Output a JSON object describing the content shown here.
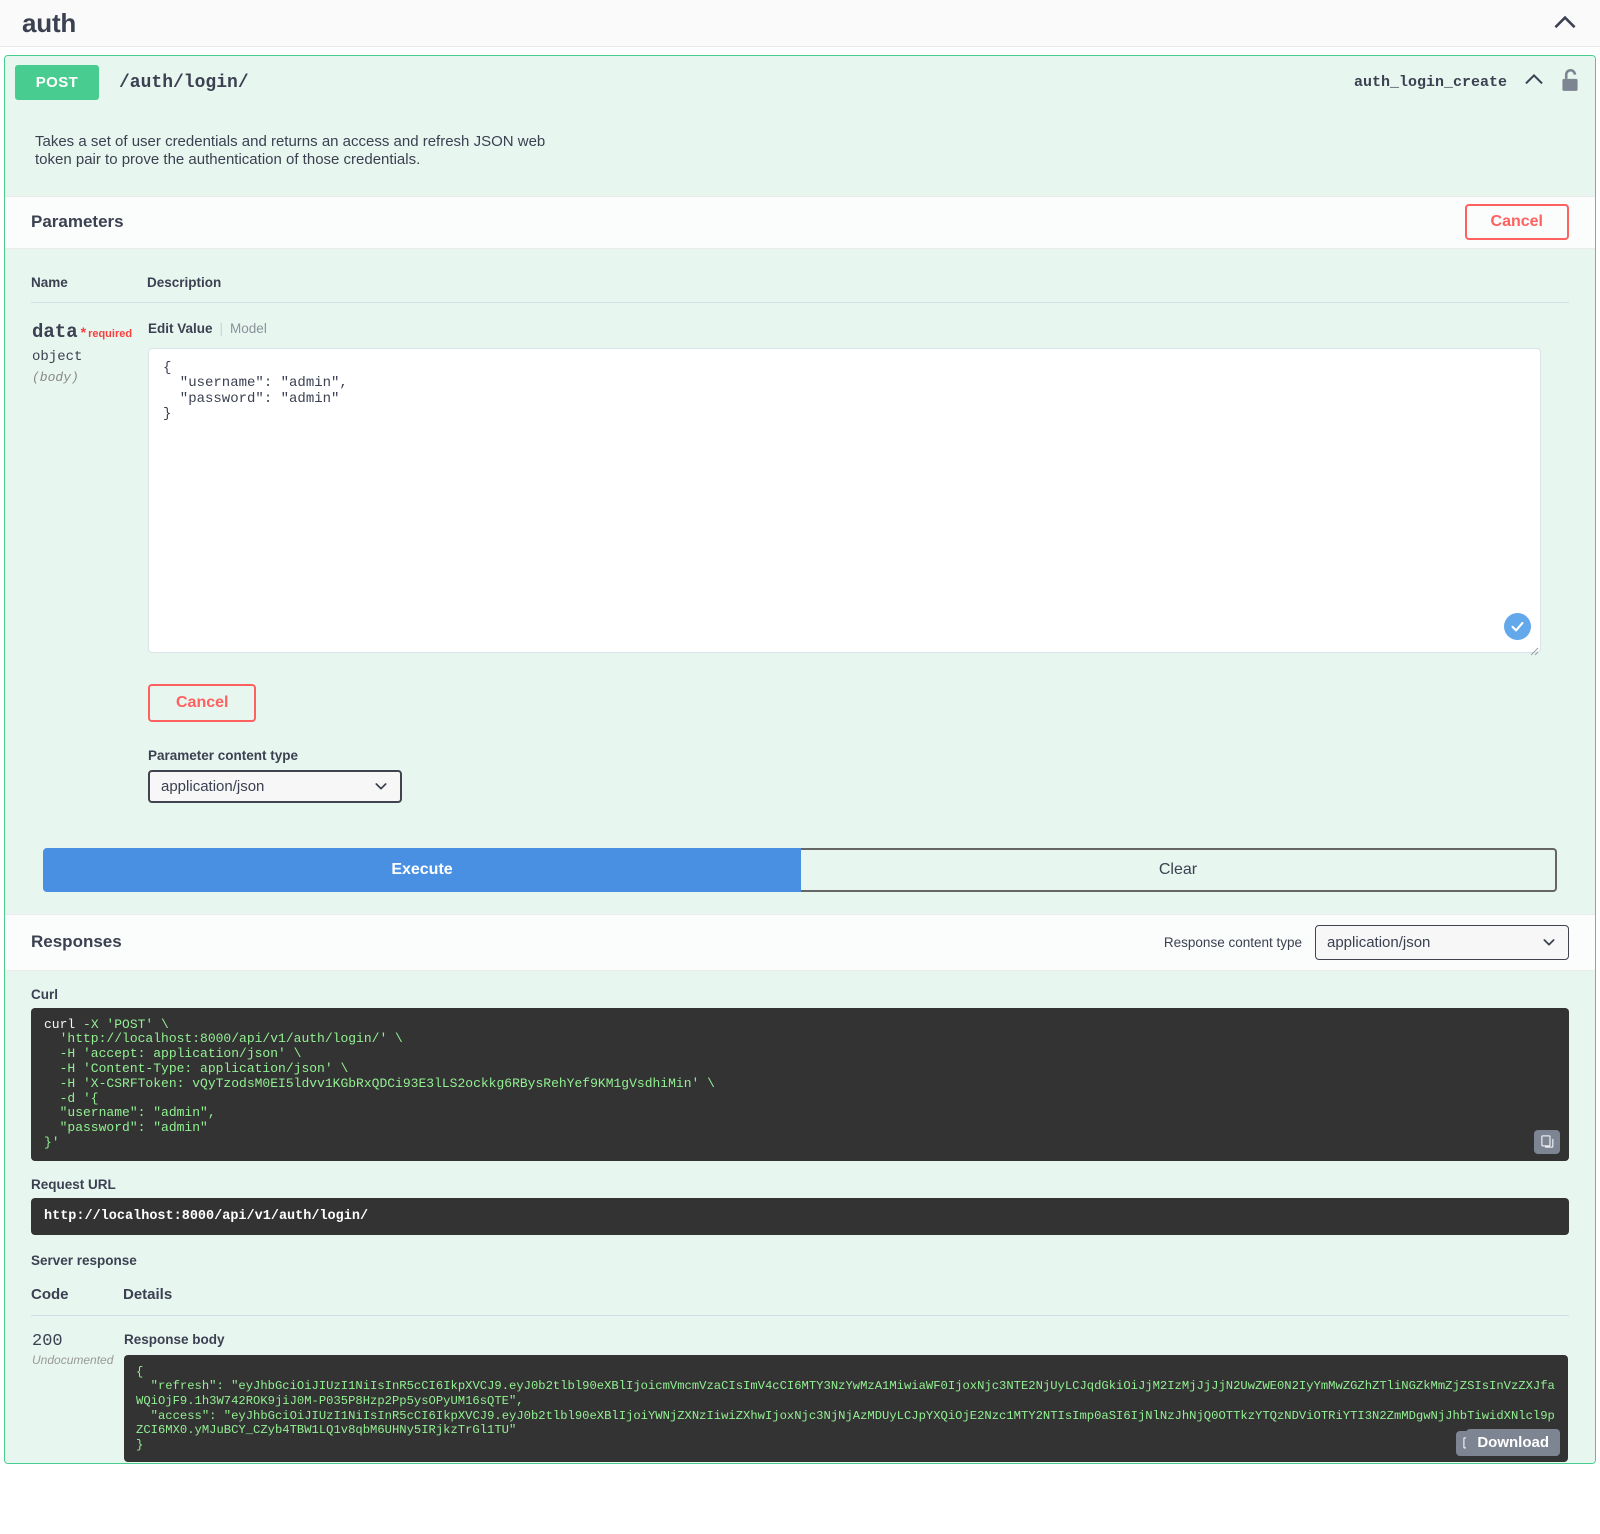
{
  "tag": {
    "title": "auth",
    "collapse_icon": "chevron-up-icon"
  },
  "operation": {
    "method": "POST",
    "path": "/auth/login/",
    "operation_id": "auth_login_create",
    "collapse_icon": "chevron-up-icon",
    "auth_icon": "unlocked-padlock-icon",
    "description": "Takes a set of user credentials and returns an access and refresh JSON web\ntoken pair to prove the authentication of those credentials.",
    "method_color": "#49cc90"
  },
  "parameters": {
    "section_title": "Parameters",
    "cancel_label": "Cancel",
    "columns": {
      "name": "Name",
      "description": "Description"
    },
    "rows": [
      {
        "name": "data",
        "required_star": "*",
        "required_label": "required",
        "type": "object",
        "location": "(body)",
        "tab_edit": "Edit Value",
        "tab_model": "Model",
        "editor_value": "{\n  \"username\": \"admin\",\n  \"password\": \"admin\"\n}",
        "valid_icon": "checkmark-circle-icon",
        "cancel_label": "Cancel",
        "content_type_label": "Parameter content type",
        "content_type_value": "application/json"
      }
    ]
  },
  "actions": {
    "execute_label": "Execute",
    "clear_label": "Clear",
    "execute_color": "#4990e2"
  },
  "responses": {
    "section_title": "Responses",
    "content_type_label": "Response content type",
    "content_type_value": "application/json",
    "curl_label": "Curl",
    "curl_command_head": "curl",
    "curl_command_rest": " -X 'POST' \\\n  'http://localhost:8000/api/v1/auth/login/' \\\n  -H 'accept: application/json' \\\n  -H 'Content-Type: application/json' \\\n  -H 'X-CSRFToken: vQyTzodsM0EI5ldvv1KGbRxQDCi93E3lLS2ockkg6RBysRehYef9KM1gVsdhiMin' \\\n  -d '{\n  \"username\": \"admin\",\n  \"password\": \"admin\"\n}'",
    "copy_icon": "copy-to-clipboard-icon",
    "request_url_label": "Request URL",
    "request_url": "http://localhost:8000/api/v1/auth/login/",
    "server_response_label": "Server response",
    "columns": {
      "code": "Code",
      "details": "Details"
    },
    "status_code": "200",
    "status_note": "Undocumented",
    "response_body_label": "Response body",
    "response_body": "{\n  \"refresh\": \"eyJhbGciOiJIUzI1NiIsInR5cCI6IkpXVCJ9.eyJ0b2tlbl90eXBlIjoicmVmcmVzaCIsImV4cCI6MTY3NzYwMzA1MiwiaWF0IjoxNjc3NTE2NjUyLCJqdGkiOiJjM2IzMjJjJjN2UwZWE0N2IyYmMwZGZhZTliNGZkMmZjZSIsInVzZXJfaWQiOjF9.1h3W742ROK9jiJ0M-P035P8Hzp2Pp5ysOPyUM16sQTE\",\n  \"access\": \"eyJhbGciOiJIUzI1NiIsInR5cCI6IkpXVCJ9.eyJ0b2tlbl90eXBlIjoiYWNjZXNzIiwiZXhwIjoxNjc3NjNjAzMDUyLCJpYXQiOjE2Nzc1MTY2NTIsImp0aSI6IjNlNzJhNjQ0OTTkzYTQzNDViOTRiYTI3N2ZmMDgwNjJhbTiwidXNlcl9pZCI6MX0.yMJuBCY_CZyb4TBW1LQ1v8qbM6UHNy5IRjkzTrGl1TU\"\n}",
    "download_label": "Download",
    "download_copy_icon": "copy-to-clipboard-icon"
  }
}
